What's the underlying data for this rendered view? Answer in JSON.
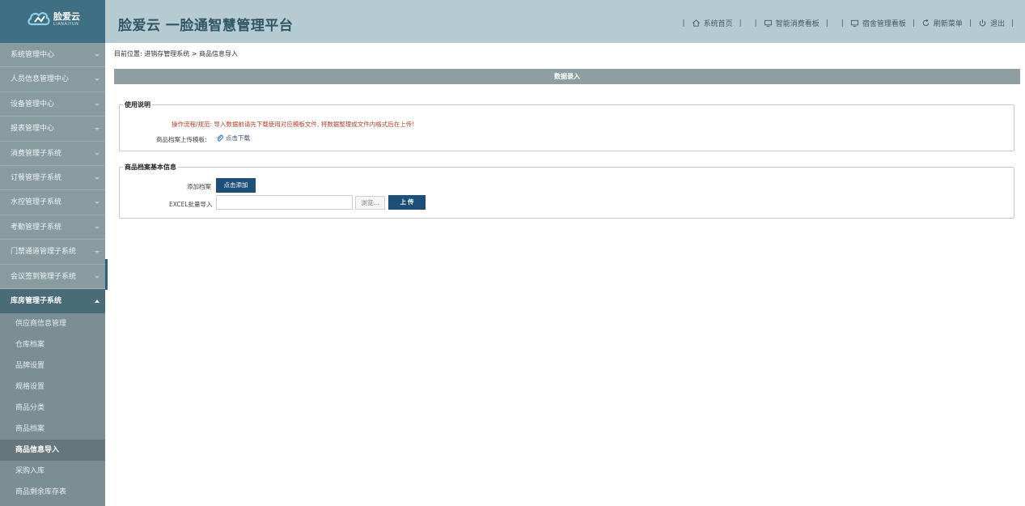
{
  "brand": {
    "name": "脸爱云",
    "subtitle": "LIANAIYUN",
    "accent": "#3e6f83"
  },
  "header": {
    "title": "脸爱云 一脸通智慧管理平台",
    "nav": [
      {
        "label": "系统首页",
        "icon": "home-icon"
      },
      {
        "label": "智能消费看板",
        "icon": "monitor-icon"
      },
      {
        "label": "宿舍管理看板",
        "icon": "monitor-icon"
      },
      {
        "label": "刷新菜单",
        "icon": "refresh-icon"
      },
      {
        "label": "退出",
        "icon": "power-icon"
      }
    ]
  },
  "sidebar": {
    "items": [
      "系统管理中心",
      "人员信息管理中心",
      "设备管理中心",
      "报表管理中心",
      "消费管理子系统",
      "订餐管理子系统",
      "水控管理子系统",
      "考勤管理子系统",
      "门禁通道管理子系统",
      "会议签到管理子系统"
    ],
    "open_group": "库房管理子系统",
    "sub_items": [
      "供应商信息管理",
      "仓库档案",
      "品牌设置",
      "规格设置",
      "商品分类",
      "商品档案",
      "商品信息导入",
      "采购入库",
      "商品剩余库存表"
    ],
    "active_sub": "商品信息导入"
  },
  "main": {
    "breadcrumb": "目前位置: 进销存管理系统 > 商品信息导入",
    "section_title": "数据录入",
    "usage": {
      "legend": "使用说明",
      "notice": "操作流程/规范: 导入数据前请先下载使用对应模板文件, 将数据整理成文件内格式后在上传!",
      "template_label": "商品档案上传模板:",
      "template_link": "点击下载"
    },
    "info": {
      "legend": "商品档案基本信息",
      "add_label": "添加档案",
      "add_button": "点击添加",
      "excel_label": "EXCEL批量导入",
      "file_value": "",
      "browse_button": "浏览...",
      "upload_button": "上 传"
    }
  }
}
